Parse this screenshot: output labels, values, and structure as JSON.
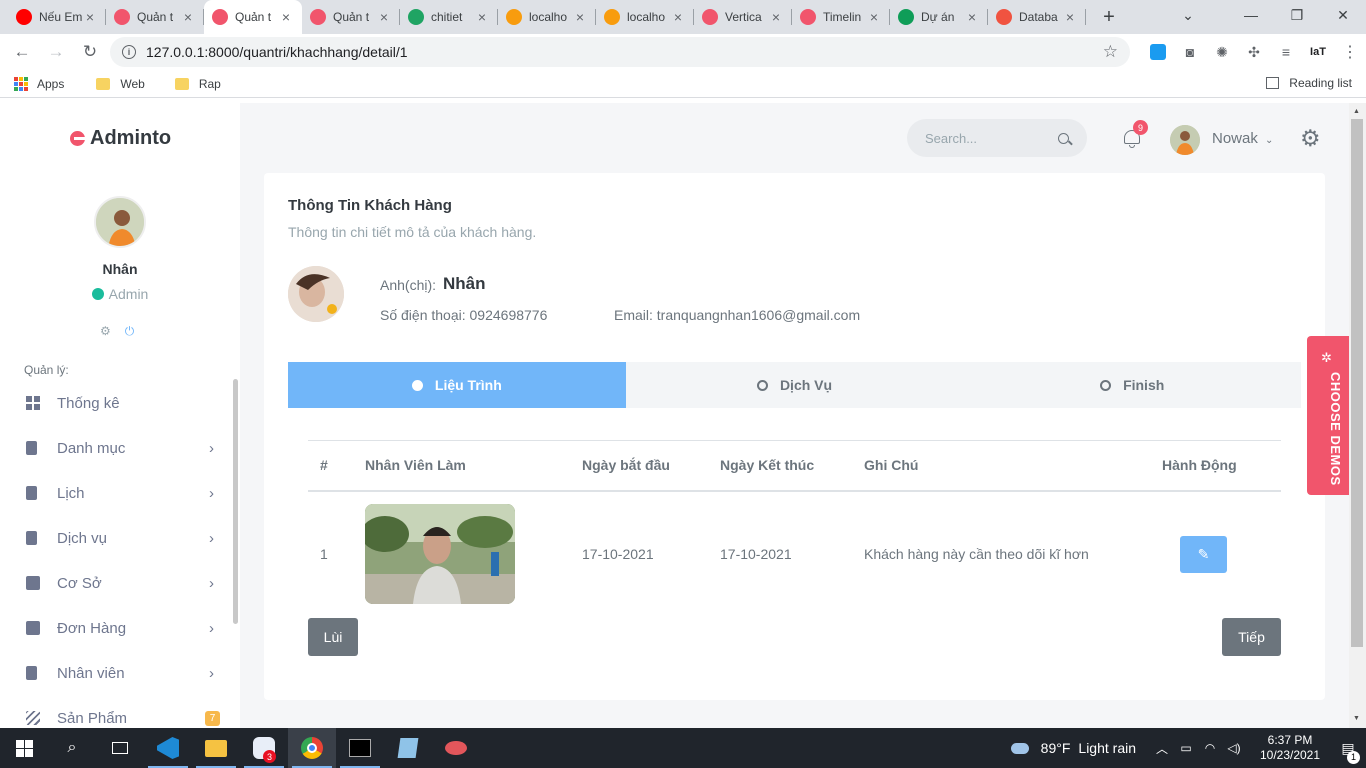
{
  "browser": {
    "tabs": [
      {
        "title": "Nếu Em",
        "favicon_color": "#ff0000",
        "favicon": "youtube-icon",
        "active": false
      },
      {
        "title": "Quản t",
        "favicon_color": "#f1556c",
        "favicon": "adminto-icon",
        "active": false
      },
      {
        "title": "Quản t",
        "favicon_color": "#f1556c",
        "favicon": "adminto-icon",
        "active": true
      },
      {
        "title": "Quản t",
        "favicon_color": "#f1556c",
        "favicon": "adminto-icon",
        "active": false
      },
      {
        "title": "chitiet",
        "favicon_color": "#1fa463",
        "favicon": "drive-icon",
        "active": false
      },
      {
        "title": "localho",
        "favicon_color": "#f89c0e",
        "favicon": "phpmyadmin-icon",
        "active": false
      },
      {
        "title": "localho",
        "favicon_color": "#f89c0e",
        "favicon": "phpmyadmin-icon",
        "active": false
      },
      {
        "title": "Vertica",
        "favicon_color": "#f1556c",
        "favicon": "adminto-icon",
        "active": false
      },
      {
        "title": "Timelin",
        "favicon_color": "#f1556c",
        "favicon": "adminto-icon",
        "active": false
      },
      {
        "title": "Dự án",
        "favicon_color": "#0f9d58",
        "favicon": "sheets-icon",
        "active": false
      },
      {
        "title": "Databa",
        "favicon_color": "#f05340",
        "favicon": "laravel-icon",
        "active": false
      }
    ],
    "new_tab_symbol": "+",
    "url": "127.0.0.1:8000/quantri/khachhang/detail/1",
    "bookmarks": [
      {
        "label": "Apps"
      },
      {
        "label": "Web"
      },
      {
        "label": "Rap"
      }
    ],
    "reading_list": "Reading list",
    "extension_text": "IaT"
  },
  "app": {
    "logo": "Adminto",
    "search_placeholder": "Search...",
    "notification_count": "9",
    "top_username": "Nowak",
    "demos_label": "CHOOSE DEMOS",
    "accent": "#71b6f9",
    "danger": "#f1556c"
  },
  "sidebar": {
    "username": "Nhân",
    "role": "Admin",
    "section_label": "Quản lý:",
    "items": [
      {
        "label": "Thống kê",
        "icon": "dashboard-icon",
        "has_children": false
      },
      {
        "label": "Danh mục",
        "icon": "book-icon",
        "has_children": true
      },
      {
        "label": "Lịch",
        "icon": "book-icon",
        "has_children": true
      },
      {
        "label": "Dịch vụ",
        "icon": "book-icon",
        "has_children": true
      },
      {
        "label": "Cơ Sở",
        "icon": "home-icon",
        "has_children": true
      },
      {
        "label": "Đơn Hàng",
        "icon": "cart-icon",
        "has_children": true
      },
      {
        "label": "Nhân viên",
        "icon": "book-icon",
        "has_children": true
      },
      {
        "label": "Sản Phẩm",
        "icon": "stripes-icon",
        "badge": "7"
      }
    ]
  },
  "card": {
    "title": "Thông Tin Khách Hàng",
    "subtitle": "Thông tin chi tiết mô tả của khách hàng.",
    "customer_prefix": "Anh(chị):",
    "customer_name": "Nhân",
    "phone_text": "Số điện thoại: 0924698776",
    "email_text": "Email: tranquangnhan1606@gmail.com"
  },
  "tabs": [
    {
      "label": "Liệu Trình",
      "active": true
    },
    {
      "label": "Dịch Vụ",
      "active": false
    },
    {
      "label": "Finish",
      "active": false
    }
  ],
  "table": {
    "headers": [
      "#",
      "Nhân Viên Làm",
      "Ngày bắt đầu",
      "Ngày Kết thúc",
      "Ghi Chú",
      "Hành Động"
    ],
    "rows": [
      {
        "index": "1",
        "start": "17-10-2021",
        "end": "17-10-2021",
        "note": "Khách hàng này cần theo dõi kĩ hơn"
      }
    ]
  },
  "pagination": {
    "prev": "Lùi",
    "next": "Tiếp"
  },
  "taskbar": {
    "weather_temp": "89°F",
    "weather_text": "Light rain",
    "time": "6:37 PM",
    "date": "10/23/2021",
    "zalo_badge": "3",
    "notification_badge": "1"
  }
}
